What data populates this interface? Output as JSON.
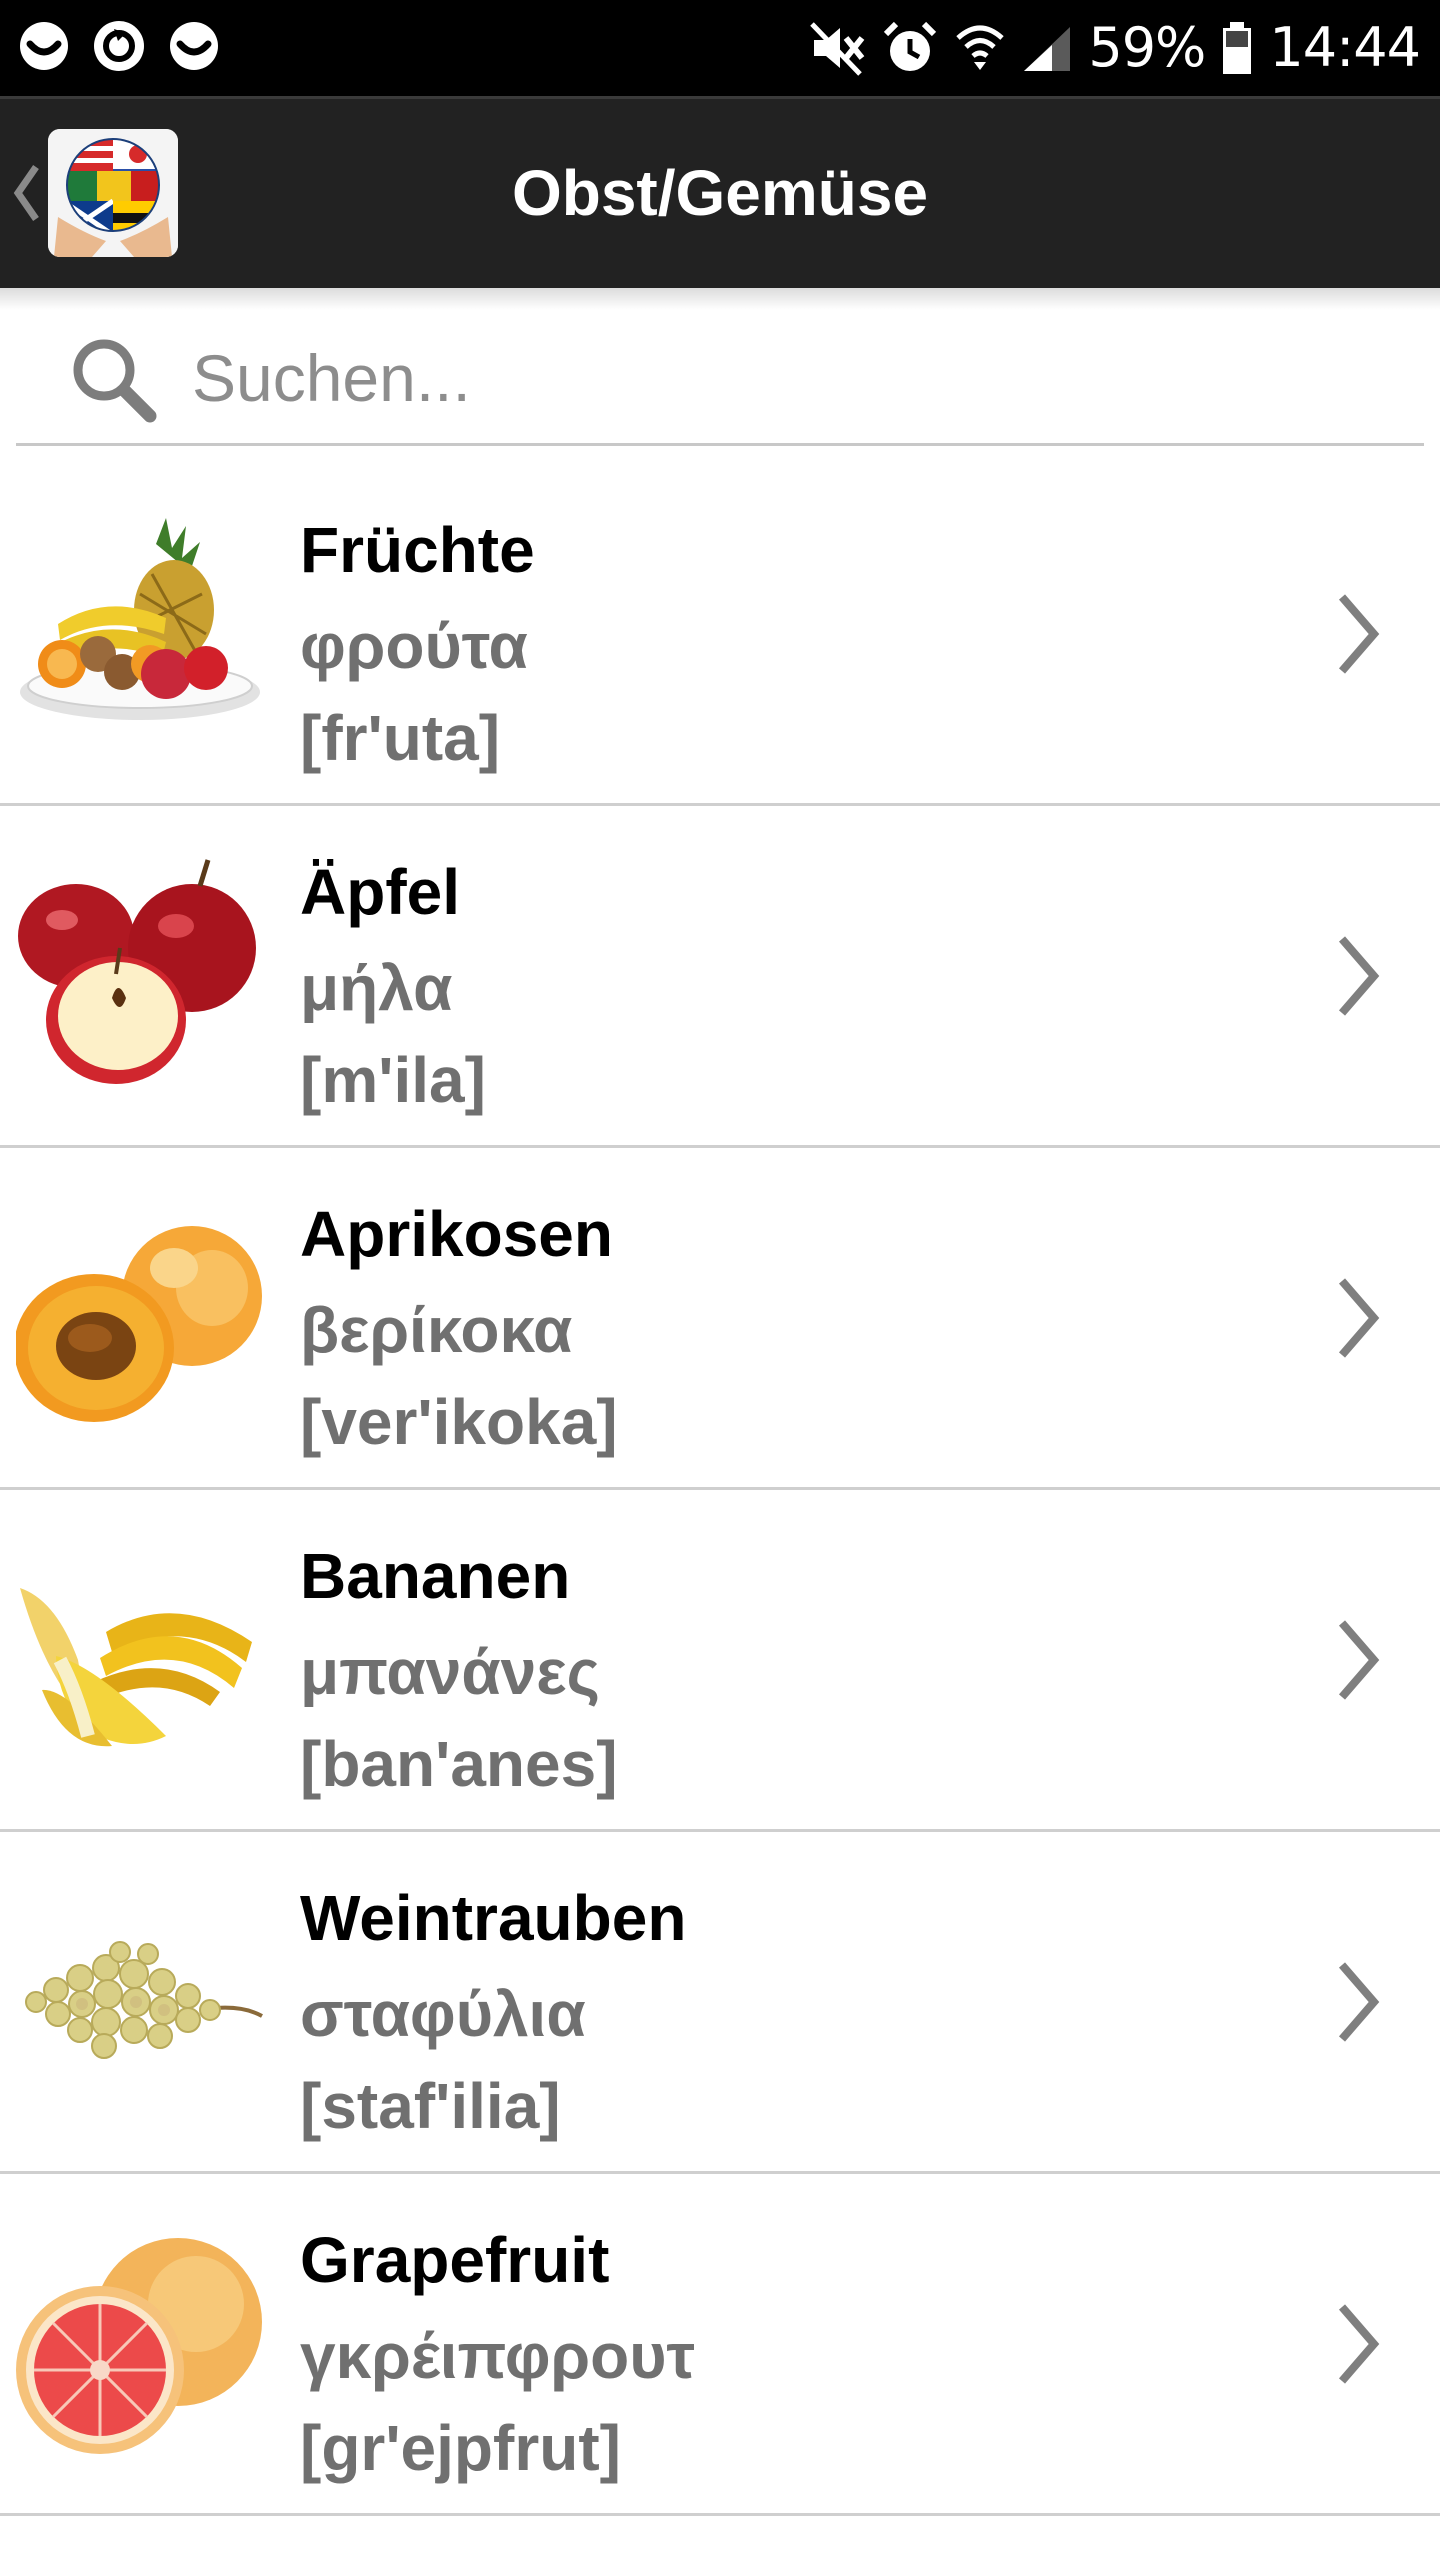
{
  "status_bar": {
    "left_icons": [
      "face-icon",
      "sync-icon",
      "face-icon"
    ],
    "right_icons": [
      "mute-icon",
      "alarm-icon",
      "wifi-icon",
      "signal-icon"
    ],
    "battery_percent": "59%",
    "time": "14:44"
  },
  "app_bar": {
    "back_icon": "chevron-left-icon",
    "logo_icon": "globe-flags-logo-icon",
    "title": "Obst/Gemüse"
  },
  "search": {
    "icon": "search-icon",
    "value": "",
    "placeholder": "Suchen..."
  },
  "items": [
    {
      "german": "Früchte",
      "greek": "φρούτα",
      "phonetic": "[fr'uta]",
      "image": "fruit-plate-icon"
    },
    {
      "german": "Äpfel",
      "greek": "μήλα",
      "phonetic": "[m'ila]",
      "image": "apples-icon"
    },
    {
      "german": "Aprikosen",
      "greek": "βερίκοκα",
      "phonetic": "[ver'ikoka]",
      "image": "apricots-icon"
    },
    {
      "german": "Bananen",
      "greek": "μπανάνες",
      "phonetic": "[ban'anes]",
      "image": "bananas-icon"
    },
    {
      "german": "Weintrauben",
      "greek": "σταφύλια",
      "phonetic": "[staf'ilia]",
      "image": "grapes-icon"
    },
    {
      "german": "Grapefruit",
      "greek": "γκρέιπφρουτ",
      "phonetic": "[gr'ejpfrut]",
      "image": "grapefruit-icon"
    }
  ],
  "colors": {
    "status_bar_bg": "#000000",
    "app_bar_bg": "#222222",
    "greek_text": "#707070",
    "divider": "#cfcfcf"
  }
}
